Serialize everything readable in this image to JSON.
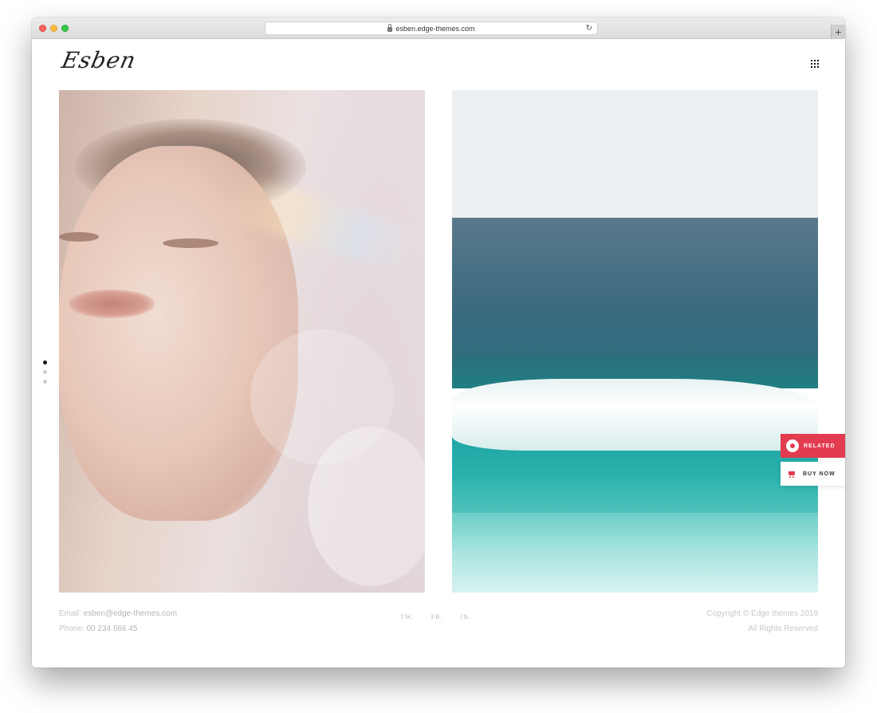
{
  "browser": {
    "url": "esben.edge-themes.com"
  },
  "header": {
    "logo_text": "Esben"
  },
  "slider": {
    "dots": [
      {
        "active": true
      },
      {
        "active": false
      },
      {
        "active": false
      }
    ]
  },
  "side_buttons": {
    "related_label": "RELATED",
    "buy_now_label": "BUY NOW"
  },
  "footer": {
    "email_label": "Email:",
    "email_value": "esben@edge-themes.com",
    "phone_label": "Phone:",
    "phone_value": "00 234 666 45",
    "social": [
      "TW.",
      "FB.",
      "IN."
    ],
    "copyright": "Copyright © Edge themes 2019",
    "rights": "All Rights Reserved"
  },
  "colors": {
    "accent": "#e33b4f"
  }
}
